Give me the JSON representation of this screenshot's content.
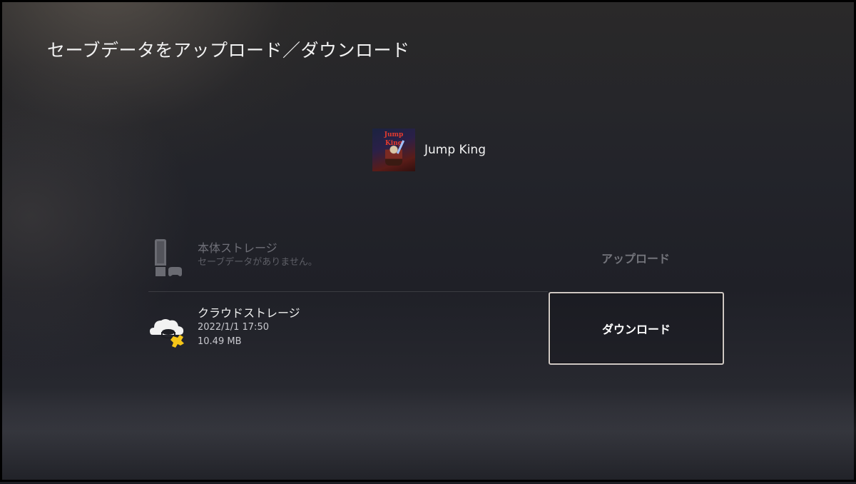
{
  "page": {
    "title": "セーブデータをアップロード／ダウンロード"
  },
  "game": {
    "title": "Jump King",
    "thumbnail_text": "Jump King"
  },
  "storage": [
    {
      "name": "本体ストレージ",
      "detail": "セーブデータがありません。",
      "action": "アップロード",
      "icon": "ps5-console-icon",
      "enabled": false
    },
    {
      "name": "クラウドストレージ",
      "date": "2022/1/1  17:50",
      "size": "10.49 MB",
      "action": "ダウンロード",
      "icon": "cloud-ps-plus-icon",
      "enabled": true
    }
  ],
  "colors": {
    "background": "#1d1e24",
    "focus_border": "#cfc8c3",
    "ps_plus": "#f5c518",
    "dim_text": "#6f7078"
  }
}
